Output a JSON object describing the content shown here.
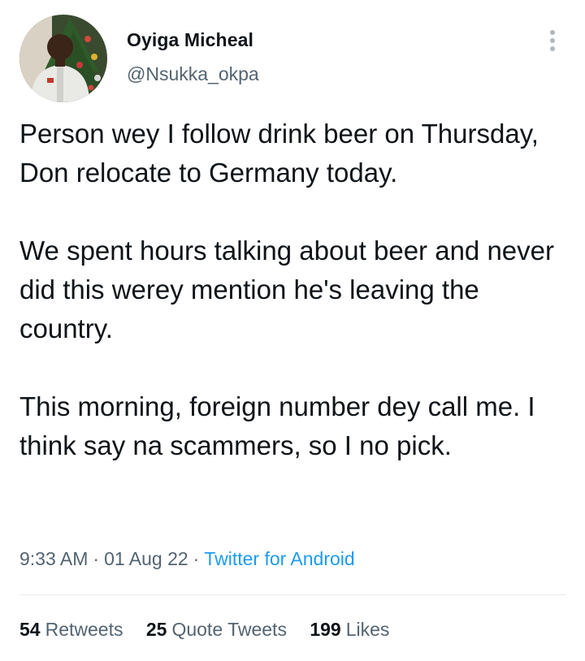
{
  "author": {
    "display_name": "Oyiga Micheal",
    "handle": "@Nsukka_okpa",
    "avatar_icon": "profile-photo-christmas-tree"
  },
  "tweet": {
    "paragraphs": [
      "Person wey I follow drink beer on Thursday, Don relocate to Germany today.",
      "We spent hours talking about beer and never did this werey mention he's leaving the country.",
      "This morning, foreign number dey call me. I think say na scammers, so I no pick."
    ],
    "time": "9:33 AM",
    "date": "01 Aug 22",
    "source": "Twitter for Android",
    "separator": "·"
  },
  "stats": [
    {
      "count": "54",
      "label": "Retweets"
    },
    {
      "count": "25",
      "label": "Quote Tweets"
    },
    {
      "count": "199",
      "label": "Likes"
    }
  ],
  "colors": {
    "text": "#0f1419",
    "secondary": "#536471",
    "link": "#1d9bf0",
    "divider": "#e6e9eb"
  },
  "icons": {
    "more": "more-vertical-icon"
  }
}
